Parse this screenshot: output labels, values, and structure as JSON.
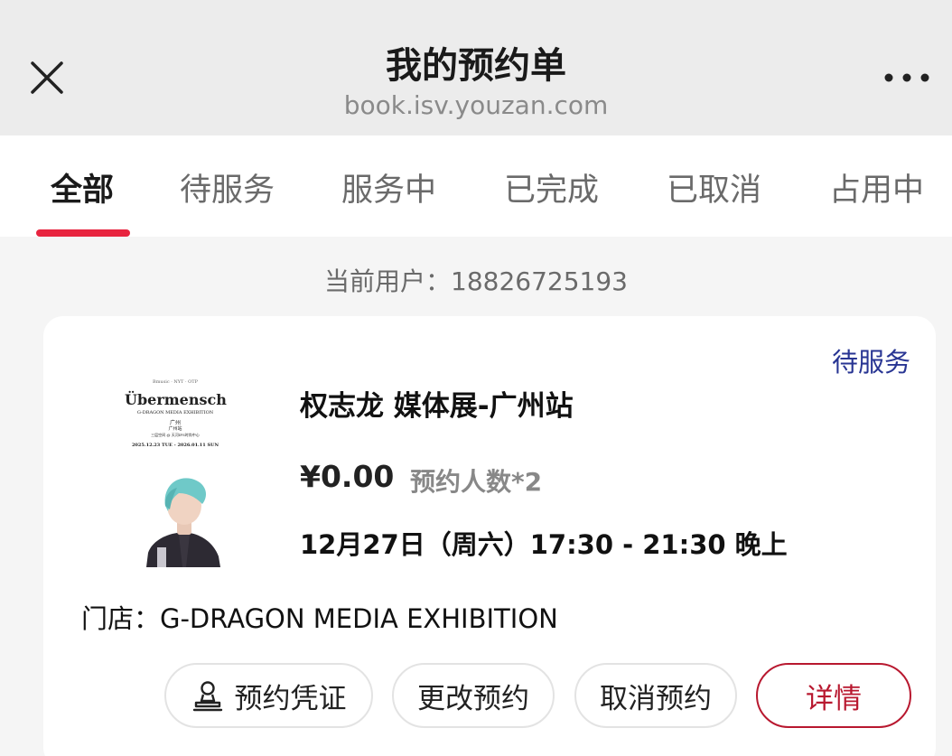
{
  "header": {
    "title": "我的预约单",
    "url": "book.isv.youzan.com",
    "close_icon": "close-icon",
    "more_icon": "more-icon"
  },
  "tabs": [
    {
      "label": "全部",
      "active": true
    },
    {
      "label": "待服务",
      "active": false
    },
    {
      "label": "服务中",
      "active": false
    },
    {
      "label": "已完成",
      "active": false
    },
    {
      "label": "已取消",
      "active": false
    },
    {
      "label": "占用中",
      "active": false
    }
  ],
  "user_line": "当前用户：18826725193",
  "booking": {
    "status": "待服务",
    "poster": {
      "sponsors": "Bmusic · NYT · OTP",
      "title": "Übermensch",
      "subtitle": "G-DRAGON MEDIA EXHIBITION",
      "city": "广州",
      "venue_line1": "广州站",
      "venue_line2": "三层空间 @ 天河IFS时尚中心",
      "dates": "2025.12.23 TUE - 2026.01.11 SUN"
    },
    "title": "权志龙 媒体展-广州站",
    "price": "¥0.00",
    "people": "预约人数*2",
    "datetime": "12月27日（周六）17:30 - 21:30 晚上",
    "store": "门店：G-DRAGON MEDIA EXHIBITION",
    "buttons": {
      "voucher": "预约凭证",
      "voucher_icon": "user-stamp-icon",
      "change": "更改预约",
      "cancel": "取消预约",
      "details": "详情"
    }
  },
  "colors": {
    "accent": "#e8243f",
    "status": "#283593",
    "details": "#b8182f"
  }
}
